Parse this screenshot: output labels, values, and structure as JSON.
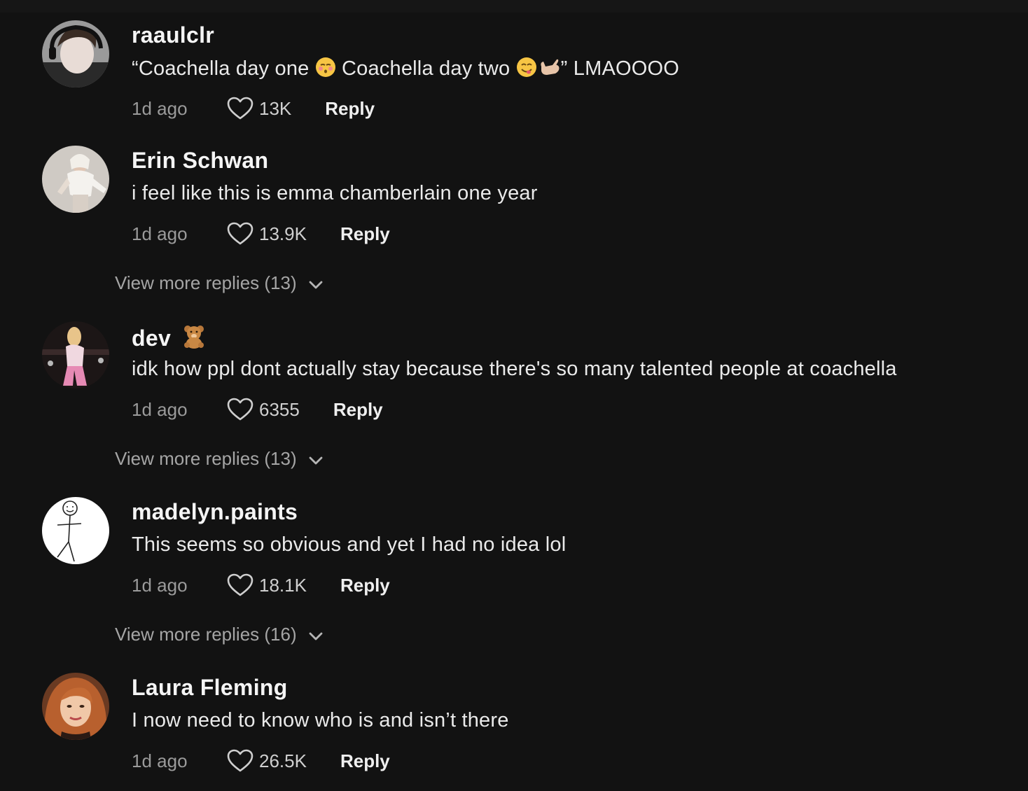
{
  "comments": [
    {
      "username": "raaulclr",
      "text_before": "“Coachella day one ",
      "text_middle": " Coachella day two ",
      "text_after": "” LMAOOOO",
      "time": "1d ago",
      "likes": "13K",
      "reply_label": "Reply",
      "emojis": [
        "kissing-face-icon",
        "yum-face-icon",
        "call-me-hand-icon"
      ]
    },
    {
      "username": "Erin Schwan",
      "text": "i feel like this is emma chamberlain one year",
      "time": "1d ago",
      "likes": "13.9K",
      "reply_label": "Reply",
      "more_replies": "View more replies (13)"
    },
    {
      "username": "dev",
      "username_emoji": "teddy-bear-icon",
      "text": "idk how ppl dont actually stay because there's so many talented people at coachella",
      "time": "1d ago",
      "likes": "6355",
      "reply_label": "Reply",
      "more_replies": "View more replies (13)"
    },
    {
      "username": "madelyn.paints",
      "text": "This seems so obvious and yet I had no idea lol",
      "time": "1d ago",
      "likes": "18.1K",
      "reply_label": "Reply",
      "more_replies": "View more replies (16)"
    },
    {
      "username": "Laura Fleming",
      "text": "I now need to know who is and isn’t there",
      "time": "1d ago",
      "likes": "26.5K",
      "reply_label": "Reply"
    }
  ],
  "colors": {
    "background": "#121212",
    "username": "#f5f5f5",
    "meta": "#9a9a9a"
  }
}
